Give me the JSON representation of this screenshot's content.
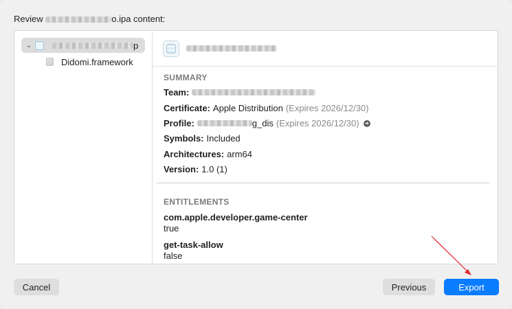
{
  "dialog": {
    "title_prefix": "Review",
    "title_suffix": "o.ipa content:"
  },
  "sidebar": {
    "app_item_suffix": "p",
    "child_item": "Didomi.framework"
  },
  "summary": {
    "heading": "SUMMARY",
    "team_label": "Team:",
    "certificate_label": "Certificate:",
    "certificate_value": "Apple Distribution",
    "certificate_expiry": "(Expires 2026/12/30)",
    "profile_label": "Profile:",
    "profile_value_suffix": "g_dis",
    "profile_expiry": "(Expires 2026/12/30)",
    "symbols_label": "Symbols:",
    "symbols_value": "Included",
    "architectures_label": "Architectures:",
    "architectures_value": "arm64",
    "version_label": "Version:",
    "version_value": "1.0 (1)"
  },
  "entitlements": {
    "heading": "ENTITLEMENTS",
    "items": [
      {
        "key": "com.apple.developer.game-center",
        "value": "true"
      },
      {
        "key": "get-task-allow",
        "value": "false"
      }
    ]
  },
  "buttons": {
    "cancel": "Cancel",
    "previous": "Previous",
    "export": "Export"
  },
  "colors": {
    "accent": "#0a7cff",
    "annotation_arrow": "#e0262b"
  }
}
